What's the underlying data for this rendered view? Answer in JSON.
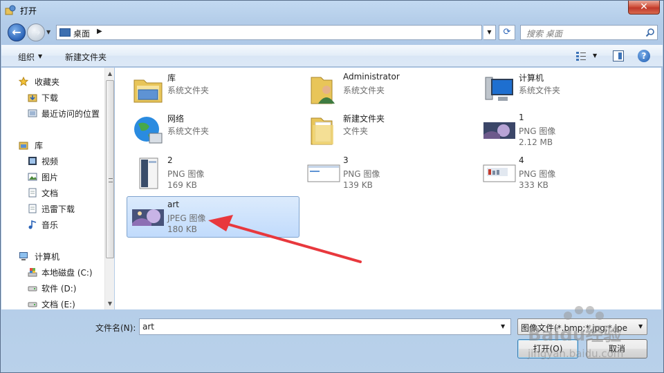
{
  "window": {
    "title": "打开",
    "close_label": "✕"
  },
  "address": {
    "crumb": "桌面",
    "search_placeholder": "搜索 桌面"
  },
  "cmdbar": {
    "organize": "组织",
    "new_folder": "新建文件夹"
  },
  "nav": {
    "favorites": {
      "label": "收藏夹",
      "items": [
        "下载",
        "最近访问的位置"
      ]
    },
    "libraries": {
      "label": "库",
      "items": [
        "视频",
        "图片",
        "文档",
        "迅雷下载",
        "音乐"
      ]
    },
    "computer": {
      "label": "计算机",
      "items": [
        "本地磁盘 (C:)",
        "软件 (D:)",
        "文档 (E:)"
      ]
    }
  },
  "files": [
    {
      "name": "库",
      "type": "系统文件夹",
      "size": "",
      "icon": "library-icon"
    },
    {
      "name": "Administrator",
      "type": "系统文件夹",
      "size": "",
      "icon": "user-folder-icon"
    },
    {
      "name": "计算机",
      "type": "系统文件夹",
      "size": "",
      "icon": "computer-icon"
    },
    {
      "name": "网络",
      "type": "系统文件夹",
      "size": "",
      "icon": "network-icon"
    },
    {
      "name": "新建文件夹",
      "type": "文件夹",
      "size": "",
      "icon": "folder-icon"
    },
    {
      "name": "1",
      "type": "PNG 图像",
      "size": "2.12 MB",
      "icon": "image-thumbnail"
    },
    {
      "name": "2",
      "type": "PNG 图像",
      "size": "169 KB",
      "icon": "image-thumbnail"
    },
    {
      "name": "3",
      "type": "PNG 图像",
      "size": "139 KB",
      "icon": "image-thumbnail"
    },
    {
      "name": "4",
      "type": "PNG 图像",
      "size": "333 KB",
      "icon": "image-thumbnail"
    },
    {
      "name": "art",
      "type": "JPEG 图像",
      "size": "180 KB",
      "icon": "image-thumbnail",
      "selected": true
    }
  ],
  "bottom": {
    "filename_label": "文件名(N):",
    "filename_value": "art",
    "filetype_value": "图像文件(*.bmp;*.jpg;*.jpe",
    "open_label": "打开(O)",
    "cancel_label": "取消"
  },
  "watermark": {
    "text": "Baidu经验",
    "url": "jingyan.baidu.com"
  },
  "colors": {
    "accent": "#2a63b7",
    "selection": "#c1dbfc",
    "annotation_arrow": "#e8383d"
  }
}
